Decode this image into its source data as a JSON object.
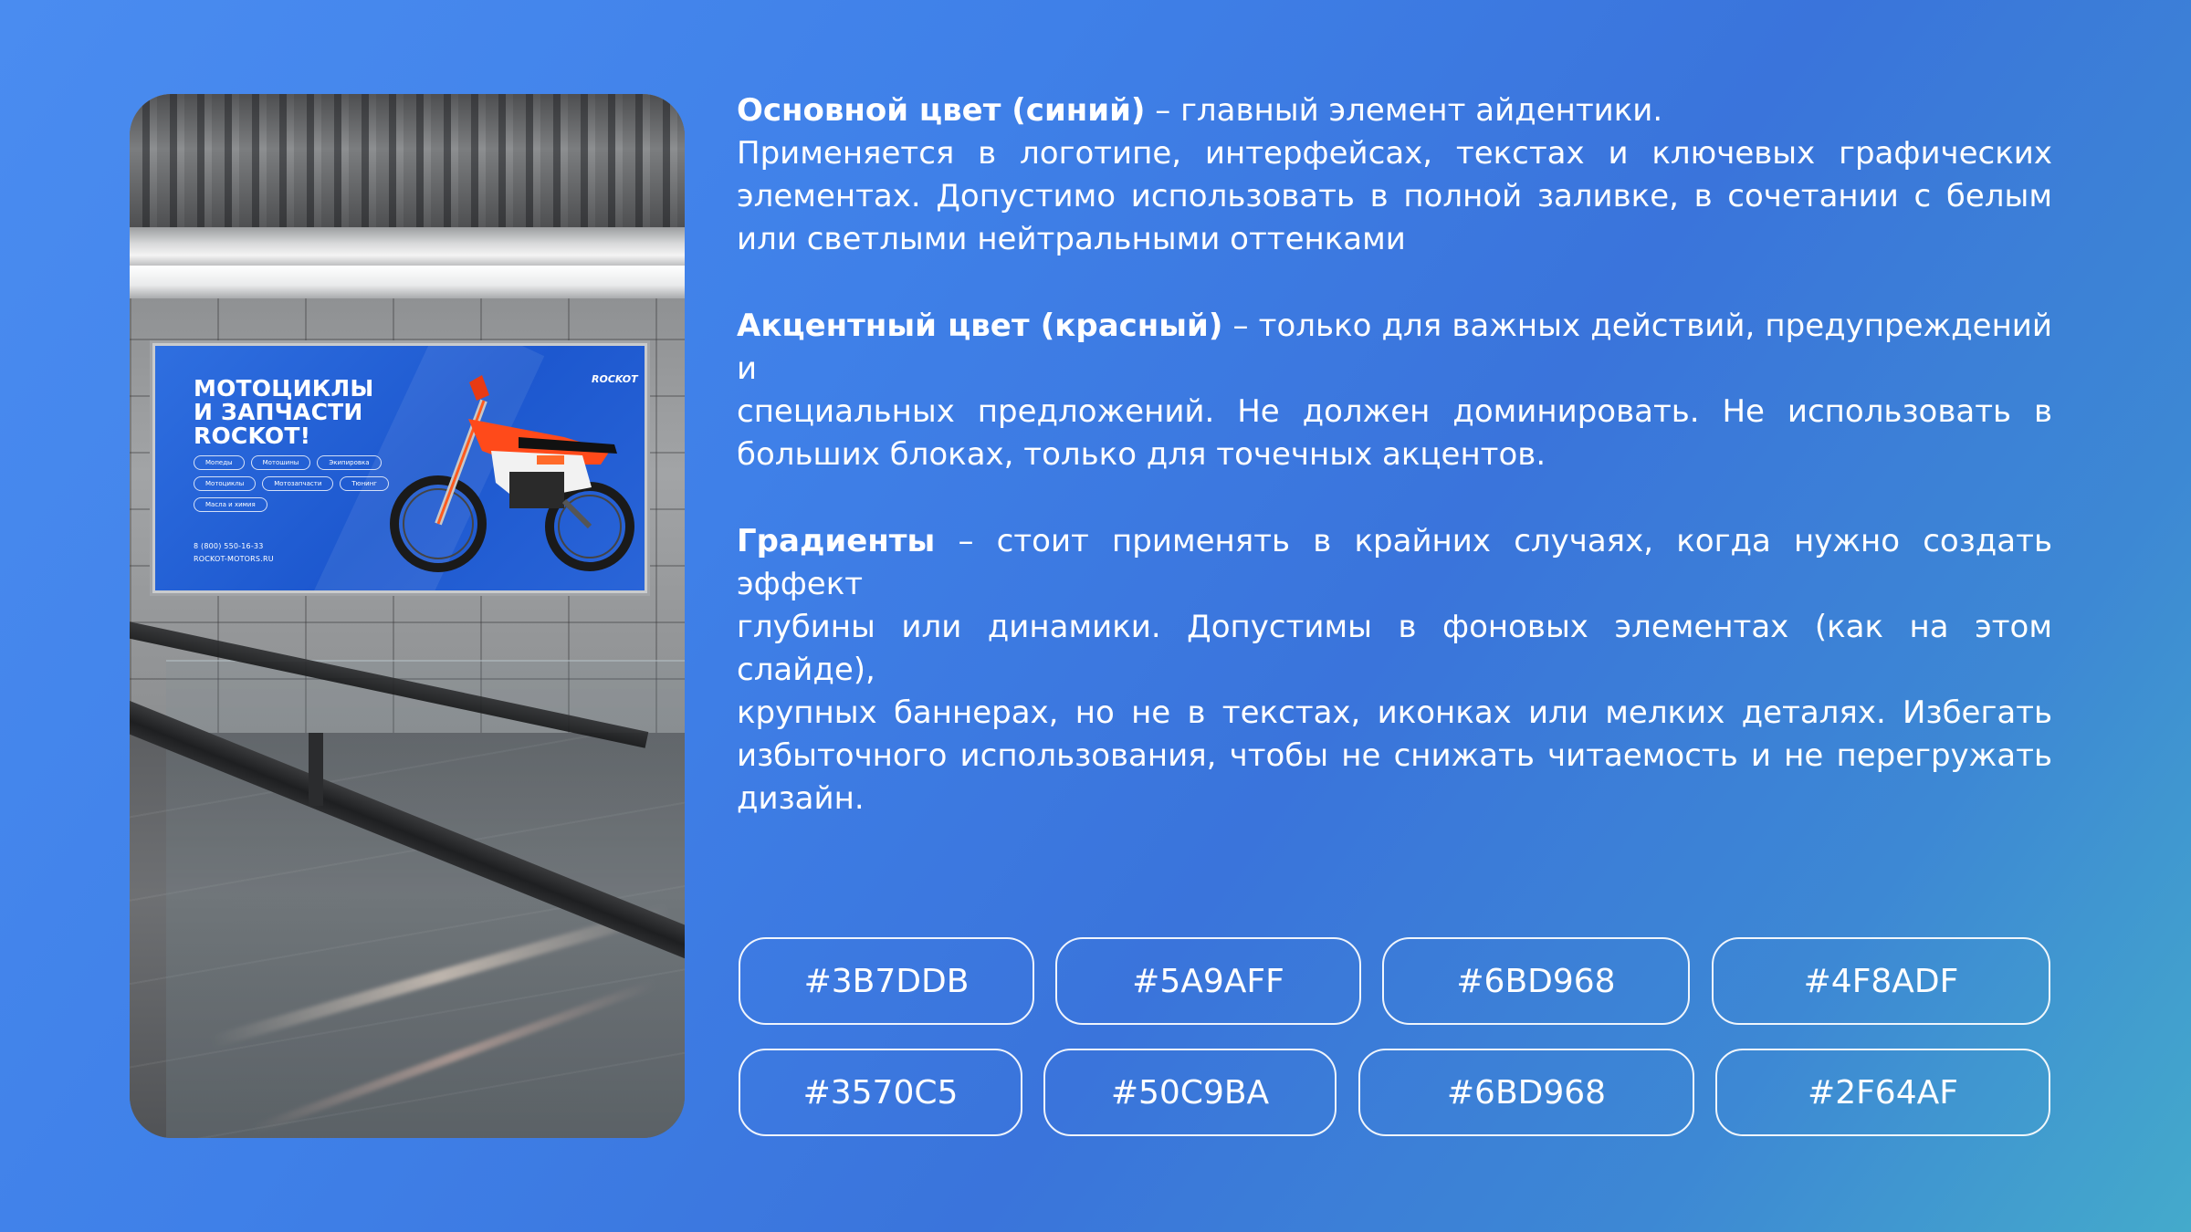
{
  "billboard": {
    "title_lines": [
      "МОТОЦИКЛЫ",
      "И ЗАПЧАСТИ",
      "ROCKOT!"
    ],
    "chips": [
      "Мопеды",
      "Мотошины",
      "Экипировка",
      "Мотоциклы",
      "Мотозапчасти",
      "Тюнинг",
      "Масла и химия"
    ],
    "phone": "8 (800) 550-16-33",
    "site": "ROCKOT-MOTORS.RU",
    "logo": "ROCKOT"
  },
  "paragraphs": [
    {
      "bold": "Основной цвет (синий)",
      "lines": [
        " – главный элемент айдентики.",
        "Применяется в логотипе, интерфейсах, текстах и ключевых графических",
        "элементах. Допустимо использовать в полной заливке, в сочетании с белым",
        "или светлыми нейтральными оттенками"
      ]
    },
    {
      "bold": "Акцентный цвет (красный)",
      "lines": [
        " – только для важных действий, предупреждений и",
        "специальных предложений. Не должен доминировать. Не использовать в",
        "больших блоках, только для точечных акцентов."
      ]
    },
    {
      "bold": "Градиенты",
      "lines": [
        " – стоит применять в крайних случаях, когда нужно создать эффект",
        "глубины или динамики. Допустимы в фоновых элементах (как на этом слайде),",
        "крупных баннерах, но не в текстах, иконках или мелких деталях. Избегать",
        "избыточного использования, чтобы не снижать читаемость и не перегружать",
        "дизайн."
      ]
    }
  ],
  "swatches_row1": [
    "#3B7DDB",
    "#5A9AFF",
    "#6BD968",
    "#4F8ADF"
  ],
  "swatches_row2": [
    "#3570C5",
    "#50C9BA",
    "#6BD968",
    "#2F64AF"
  ]
}
